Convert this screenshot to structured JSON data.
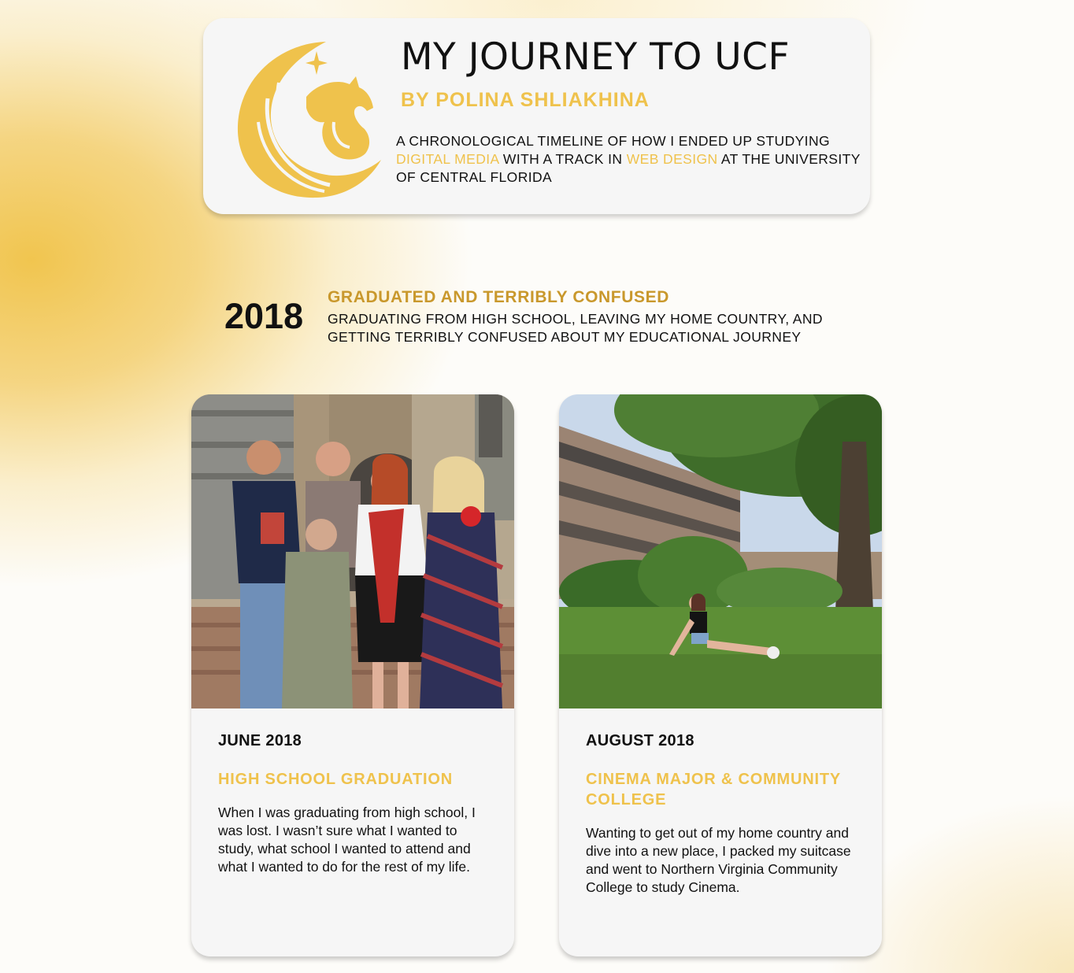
{
  "header": {
    "title": "MY JOURNEY TO UCF",
    "byline": "BY POLINA SHLIAKHINA",
    "description": {
      "part1": "A CHRONOLOGICAL TIMELINE OF HOW I ENDED UP STUDYING ",
      "highlight1": "DIGITAL MEDIA",
      "part2": " WITH A TRACK IN ",
      "highlight2": "WEB DESIGN",
      "part3": " AT THE UNIVERSITY OF CENTRAL FLORIDA"
    },
    "logo_icon": "pegasus-logo-icon"
  },
  "timeline": {
    "year": "2018",
    "heading": "GRADUATED AND TERRIBLY CONFUSED",
    "subheading": "GRADUATING FROM HIGH SCHOOL, LEAVING MY HOME COUNTRY, AND GETTING TERRIBLY CONFUSED ABOUT MY EDUCATIONAL JOURNEY"
  },
  "cards": [
    {
      "date": "JUNE 2018",
      "title": "HIGH SCHOOL GRADUATION",
      "text": "When I was graduating from high school, I was lost. I wasn’t sure what I wanted to study, what school I wanted to attend and what I wanted to do for the rest of my life."
    },
    {
      "date": "AUGUST 2018",
      "title": "CINEMA MAJOR & COMMUNITY COLLEGE",
      "text": "Wanting to get out of my home country and dive into a new place, I packed my suitcase and went to Northern Virginia Community College to study Cinema."
    }
  ],
  "colors": {
    "accent_gold": "#efc24c",
    "heading_gold": "#c9982c",
    "card_bg": "#f6f6f6"
  }
}
